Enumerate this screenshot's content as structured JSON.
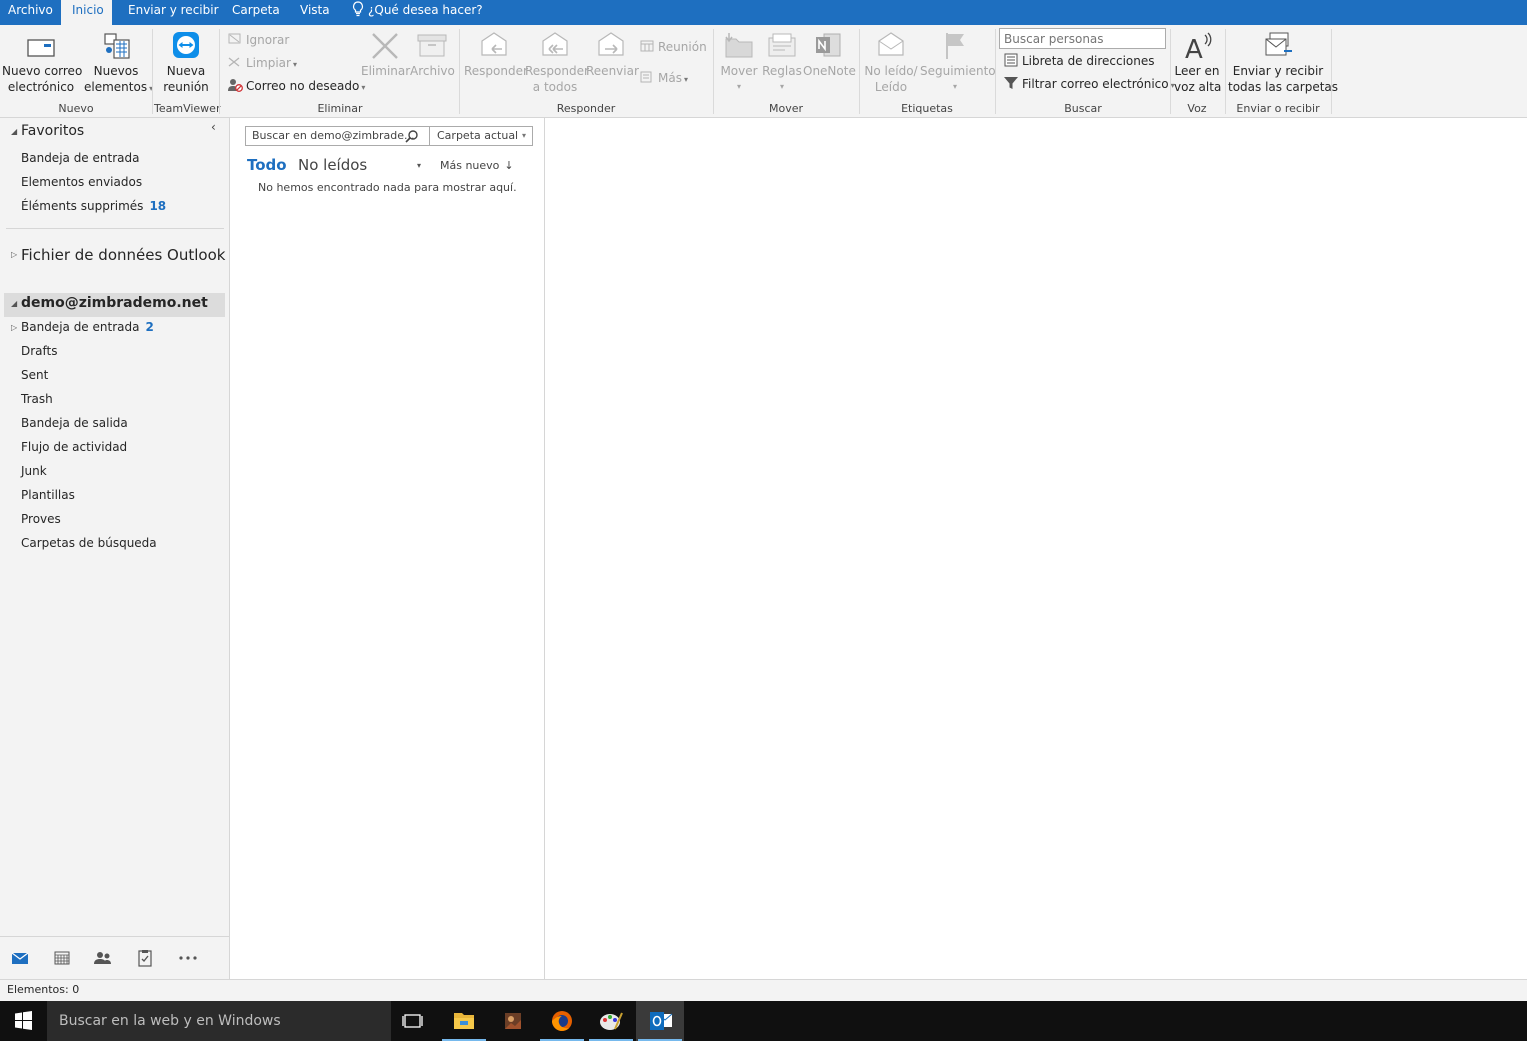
{
  "menu_tabs": [
    "Archivo",
    "Inicio",
    "Enviar y recibir",
    "Carpeta",
    "Vista"
  ],
  "tell_me": "¿Qué desea hacer?",
  "ribbon": {
    "nuevo": {
      "new_email_1": "Nuevo correo",
      "new_email_2": "electrónico",
      "new_items_1": "Nuevos",
      "new_items_2": "elementos",
      "group": "Nuevo"
    },
    "teamviewer": {
      "meeting_1": "Nueva",
      "meeting_2": "reunión",
      "group": "TeamViewer"
    },
    "eliminar": {
      "ignore": "Ignorar",
      "clean": "Limpiar",
      "junk": "Correo no deseado",
      "delete": "Eliminar",
      "archive": "Archivo",
      "group": "Eliminar"
    },
    "responder": {
      "reply": "Responder",
      "reply_all_1": "Responder",
      "reply_all_2": "a todos",
      "forward": "Reenviar",
      "meeting": "Reunión",
      "more": "Más",
      "group": "Responder"
    },
    "mover": {
      "move": "Mover",
      "rules": "Reglas",
      "onenote": "OneNote",
      "group": "Mover"
    },
    "etiquetas": {
      "unread_1": "No leído/",
      "unread_2": "Leído",
      "followup": "Seguimiento",
      "group": "Etiquetas"
    },
    "buscar": {
      "search_people_placeholder": "Buscar personas",
      "address_book": "Libreta de direcciones",
      "filter_email": "Filtrar correo electrónico",
      "group": "Buscar"
    },
    "voz": {
      "read_aloud_1": "Leer en",
      "read_aloud_2": "voz alta",
      "group": "Voz"
    },
    "sendrecv": {
      "all_1": "Enviar y recibir",
      "all_2": "todas las carpetas",
      "group": "Enviar o recibir"
    }
  },
  "nav": {
    "favorites_title": "Favoritos",
    "favorites": [
      {
        "label": "Bandeja de entrada",
        "count": ""
      },
      {
        "label": "Elementos enviados",
        "count": ""
      },
      {
        "label": "Éléments supprimés",
        "count": "18"
      }
    ],
    "data_file": "Fichier de données Outlook",
    "account": "demo@zimbrademo.net",
    "folders": [
      {
        "label": "Bandeja de entrada",
        "count": "2"
      },
      {
        "label": "Drafts",
        "count": ""
      },
      {
        "label": "Sent",
        "count": ""
      },
      {
        "label": "Trash",
        "count": ""
      },
      {
        "label": "Bandeja de salida",
        "count": ""
      },
      {
        "label": "Flujo de actividad",
        "count": ""
      },
      {
        "label": "Junk",
        "count": ""
      },
      {
        "label": "Plantillas",
        "count": ""
      },
      {
        "label": "Proves",
        "count": ""
      },
      {
        "label": "Carpetas de búsqueda",
        "count": ""
      }
    ]
  },
  "list": {
    "search_text": "Buscar en demo@zimbrade...",
    "scope": "Carpeta actual",
    "filter_all": "Todo",
    "filter_unread": "No leídos",
    "sort": "Más nuevo",
    "empty_message": "No hemos encontrado nada para mostrar aquí."
  },
  "status": {
    "items": "Elementos: 0"
  },
  "taskbar": {
    "search_text": "Buscar en la web y en Windows"
  },
  "colors": {
    "accent": "#1e6fc0",
    "disabled": "#a6a6a6",
    "ribbon_bg": "#f3f3f3",
    "taskbar": "#101010"
  }
}
